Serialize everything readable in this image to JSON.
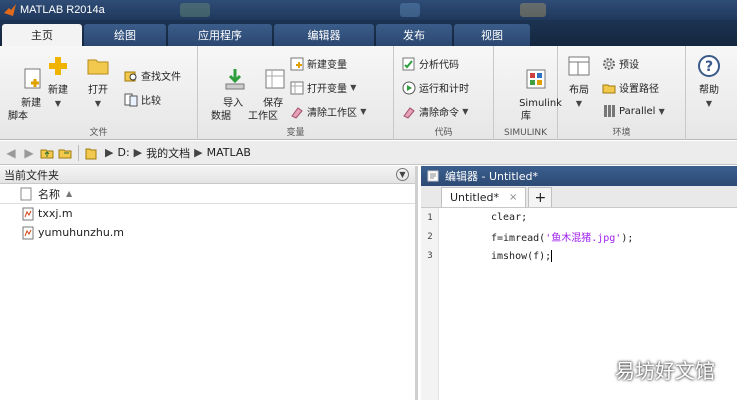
{
  "app": {
    "title": "MATLAB R2014a"
  },
  "tabs": [
    "主页",
    "绘图",
    "应用程序",
    "编辑器",
    "发布",
    "视图"
  ],
  "ribbon": {
    "file_group": {
      "label": "文件",
      "new_script": "新建\n脚本",
      "new": "新建",
      "open": "打开",
      "find_files": "查找文件",
      "compare": "比较"
    },
    "var_group": {
      "label": "变量",
      "import_data": "导入\n数据",
      "save_workspace": "保存\n工作区",
      "new_variable": "新建变量",
      "open_variable": "打开变量",
      "clear_workspace": "清除工作区"
    },
    "code_group": {
      "label": "代码",
      "analyze_code": "分析代码",
      "run_and_time": "运行和计时",
      "clear_commands": "清除命令"
    },
    "simulink_group": {
      "label": "SIMULINK",
      "simulink_library": "Simulink\n库"
    },
    "env_group": {
      "label": "环境",
      "layout": "布局",
      "preferences": "预设",
      "set_path": "设置路径",
      "parallel": "Parallel"
    },
    "help": "帮助"
  },
  "address": {
    "path": [
      "D:",
      "我的文档",
      "MATLAB"
    ]
  },
  "current_folder": {
    "title": "当前文件夹",
    "column_name": "名称",
    "files": [
      "txxj.m",
      "yumuhunzhu.m"
    ]
  },
  "editor": {
    "title": "编辑器 - Untitled*",
    "tab_label": "Untitled*",
    "lines": [
      {
        "num": "1",
        "code": "clear;"
      },
      {
        "num": "2",
        "code_before": "f=imread(",
        "code_string": "'鱼木混猪.jpg'",
        "code_after": ");"
      },
      {
        "num": "3",
        "code": "imshow(f);"
      }
    ]
  },
  "watermark": "易坊好文馆",
  "colors": {
    "titlebar": "#2f4d77",
    "tabstrip": "#1c3352",
    "string": "#a020f0"
  }
}
